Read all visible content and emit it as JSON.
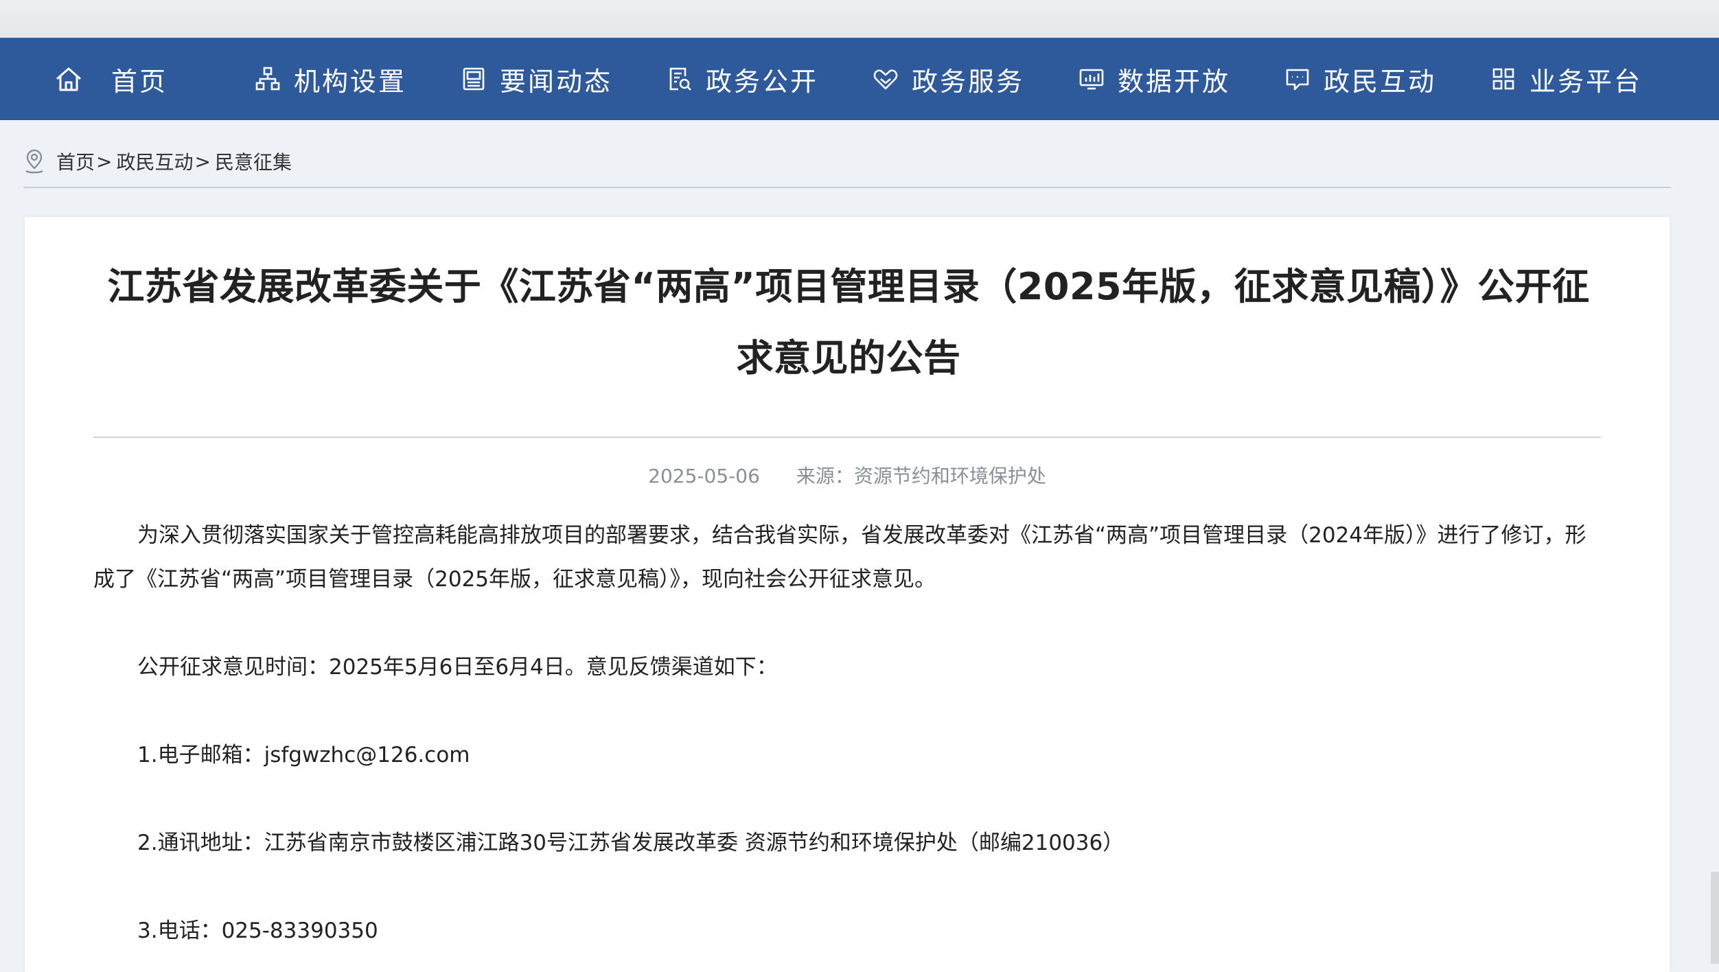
{
  "nav": {
    "items": [
      {
        "label": "首页",
        "icon": "home-icon"
      },
      {
        "label": "机构设置",
        "icon": "org-chart-icon"
      },
      {
        "label": "要闻动态",
        "icon": "news-icon"
      },
      {
        "label": "政务公开",
        "icon": "document-search-icon"
      },
      {
        "label": "政务服务",
        "icon": "service-heart-icon"
      },
      {
        "label": "数据开放",
        "icon": "data-monitor-icon"
      },
      {
        "label": "政民互动",
        "icon": "chat-bubble-icon"
      },
      {
        "label": "业务平台",
        "icon": "grid-apps-icon"
      }
    ]
  },
  "breadcrumb": {
    "home": "首页",
    "level2": "政民互动",
    "level3": "民意征集",
    "sep": ">"
  },
  "article": {
    "title": "江苏省发展改革委关于《江苏省“两高”项目管理目录（2025年版，征求意见稿）》公开征求意见的公告",
    "date": "2025-05-06",
    "source": "来源：资源节约和环境保护处",
    "paragraphs": [
      "为深入贯彻落实国家关于管控高耗能高排放项目的部署要求，结合我省实际，省发展改革委对《江苏省“两高”项目管理目录（2024年版）》进行了修订，形成了《江苏省“两高”项目管理目录（2025年版，征求意见稿）》，现向社会公开征求意见。",
      "公开征求意见时间：2025年5月6日至6月4日。意见反馈渠道如下：",
      "1.电子邮箱：jsfgwzhc@126.com",
      "2.通讯地址：江苏省南京市鼓楼区浦江路30号江苏省发展改革委 资源节约和环境保护处（邮编210036）",
      "3.电话：025-83390350"
    ]
  },
  "colors": {
    "nav_bg": "#2e5a9c",
    "page_bg": "#eef1f6",
    "meta_text": "#8a8f97"
  }
}
